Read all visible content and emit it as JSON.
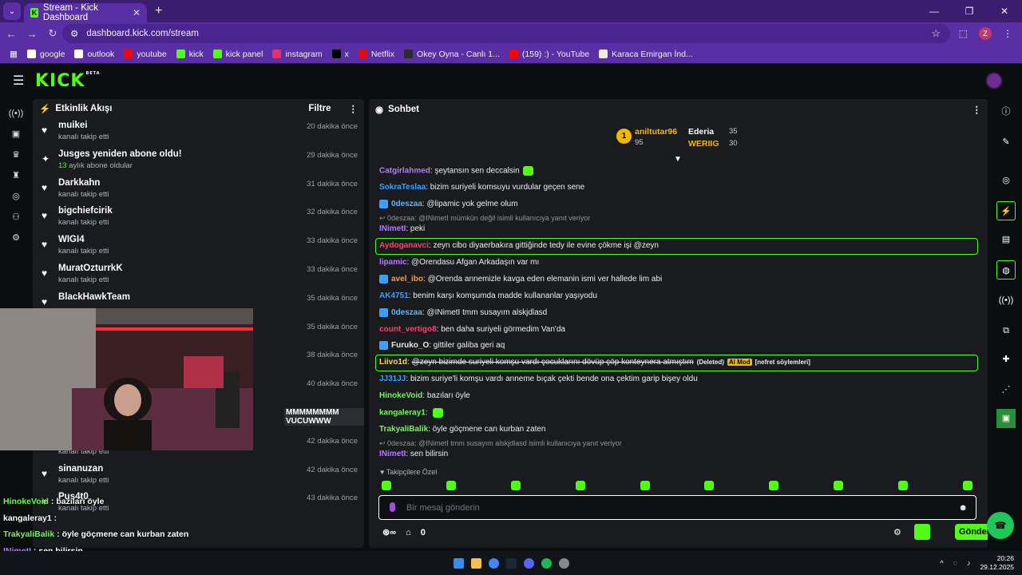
{
  "browser": {
    "tab_title": "Stream - Kick Dashboard",
    "url": "dashboard.kick.com/stream",
    "profile_initial": "Z",
    "bookmarks": [
      {
        "label": "google",
        "color": "#ffffff"
      },
      {
        "label": "outlook",
        "color": "#ffffff"
      },
      {
        "label": "youtube",
        "color": "#ff0000"
      },
      {
        "label": "kick",
        "color": "#53fc18"
      },
      {
        "label": "kick panel",
        "color": "#53fc18"
      },
      {
        "label": "instagram",
        "color": "#e1306c"
      },
      {
        "label": "x",
        "color": "#000000"
      },
      {
        "label": "Netflix",
        "color": "#e50914"
      },
      {
        "label": "Okey Oyna - Canlı 1...",
        "color": "#2c2c2c"
      },
      {
        "label": "(159) :) - YouTube",
        "color": "#ff0000"
      },
      {
        "label": "Karaca Emirgan İnd...",
        "color": "#eaeaea"
      }
    ]
  },
  "header": {
    "logo": "KICK",
    "logo_badge": "BETA"
  },
  "activity": {
    "title": "Etkinlik Akışı",
    "filter_label": "Filtre",
    "items": [
      {
        "name": "muikei",
        "sub": "kanalı takip etti",
        "time": "20 dakika önce",
        "icon": "heart"
      },
      {
        "name": "Jusges yeniden abone oldu!",
        "sub_count": "13",
        "sub": " aylık abone oldular",
        "time": "29 dakika önce",
        "icon": "sparkle"
      },
      {
        "name": "Darkkahn",
        "sub": "kanalı takip etti",
        "time": "31 dakika önce",
        "icon": "heart"
      },
      {
        "name": "bigchiefcirik",
        "sub": "kanalı takip etti",
        "time": "32 dakika önce",
        "icon": "heart"
      },
      {
        "name": "WIGI4",
        "sub": "kanalı takip etti",
        "time": "33 dakika önce",
        "icon": "heart"
      },
      {
        "name": "MuratOzturrkK",
        "sub": "kanalı takip etti",
        "time": "33 dakika önce",
        "icon": "heart"
      },
      {
        "name": "BlackHawkTeam",
        "sub": "",
        "time": "35 dakika önce",
        "icon": "heart"
      },
      {
        "name": "",
        "sub": "",
        "time": "35 dakika önce",
        "icon": ""
      },
      {
        "name": "",
        "sub": "",
        "time": "38 dakika önce",
        "icon": ""
      },
      {
        "name": "",
        "sub": "",
        "time": "40 dakika önce",
        "icon": ""
      },
      {
        "name": "",
        "sub": "",
        "time": "41 dakika önce",
        "icon": ""
      },
      {
        "name": "rasheet",
        "sub": "kanalı takip etti",
        "time": "42 dakika önce",
        "icon": "heart"
      },
      {
        "name": "sinanuzan",
        "sub": "kanalı takip etti",
        "time": "42 dakika önce",
        "icon": "heart"
      },
      {
        "name": "Pus4t0",
        "sub": "kanalı takip etti",
        "time": "43 dakika önce",
        "icon": "heart"
      }
    ],
    "highlight_msg": "MMMMMMMM VUCUWWW"
  },
  "overlay_chat": [
    {
      "user": "HinokeVoid",
      "user_color": "#6dfc4f",
      "text": "bazıları öyle"
    },
    {
      "user": "kangaleray1",
      "user_color": "#ffffff",
      "text": ""
    },
    {
      "user": "TrakyaliBalik",
      "user_color": "#6dfc4f",
      "text": "öyle göçmene can kurban zaten"
    },
    {
      "user": "INimetI",
      "user_color": "#b57aff",
      "text": "sen bilirsin"
    }
  ],
  "chat": {
    "title": "Sohbet",
    "leaderboard": {
      "rank": "1",
      "top_user": "aniltutar96",
      "top_points": "95",
      "second_user": "Ederia",
      "second_points": "35",
      "third_user": "WERIIG",
      "third_points": "30"
    },
    "messages": [
      {
        "user": "Catgirlahmed",
        "color": "#b57aff",
        "text": "şeytansın sen deccalsin",
        "emote": true
      },
      {
        "user": "SokraTeslaa",
        "color": "#3aa0ff",
        "text": "bizim suriyeli komsuyu vurdular geçen sene"
      },
      {
        "user": "0deszaa",
        "color": "#57b7ff",
        "text": "@lipamic yok gelme olum",
        "badge": true
      },
      {
        "reply": "0deszaa: @INimetI mümkün değil isimli kullanıcıya yanıt veriyor"
      },
      {
        "user": "INimetI",
        "color": "#b57aff",
        "text": "peki"
      },
      {
        "user": "Aydoganavci",
        "color": "#ff3f6e",
        "text": "zeyn cibo diyaerbakıra gittiğinde tedy ile evine çökme işi @zeyn",
        "highlight": true
      },
      {
        "user": "lipamic",
        "color": "#b57aff",
        "text": "@Orendasu Afgan Arkadaşın var mı"
      },
      {
        "user": "avel_ibo",
        "color": "#ff9a3a",
        "text": "@Orenda annemizle kavga eden elemanin ismi ver hallede lim abi",
        "badge": true
      },
      {
        "user": "AK4751",
        "color": "#3aa0ff",
        "text": "benim karşı komşumda madde kullananlar yaşıyodu"
      },
      {
        "user": "0deszaa",
        "color": "#57b7ff",
        "text": "@INimetI tmm susayım alskjdlasd",
        "badge": true
      },
      {
        "user": "count_vertigo8",
        "color": "#ff3f6e",
        "text": "ben daha suriyeli görmedim Van'da"
      },
      {
        "user": "Furuko_O",
        "color": "#e8e8e8",
        "text": "gittiler galiba geri aq",
        "badge": true
      },
      {
        "user": "Liivo1d",
        "color": "#ffd84d",
        "text": "@zeyn bizimde suriyeli komşu vardı çocuklarını dövüp çöp konteynera atmıştım",
        "deleted": "(Deleted)",
        "mod": "AI Mod",
        "reason": "[nefret söylemleri]",
        "highlight": true
      },
      {
        "user": "JJ31JJ",
        "color": "#3aa0ff",
        "text": "bizim suriye'li komşu vardı anneme bıçak çekti bende ona çektim garip bişey oldu"
      },
      {
        "user": "HinokeVoid",
        "color": "#6dfc4f",
        "text": "bazıları öyle"
      },
      {
        "user": "kangaleray1",
        "color": "#6dfc4f",
        "text": "",
        "emote": true
      },
      {
        "user": "TrakyaliBalik",
        "color": "#6dfc4f",
        "text": "öyle göçmene can kurban zaten"
      },
      {
        "reply": "0deszaa: @INimetI tmm susayım alskjdlasd isimli kullanıcıya yanıt veriyor"
      },
      {
        "user": "INimetI",
        "color": "#b57aff",
        "text": "sen bilirsin"
      }
    ],
    "followers_only": "Takipçilere Özel",
    "input_placeholder": "Bir mesaj gönderin",
    "send_label": "Gönder",
    "viewer_count": "0"
  },
  "taskbar": {
    "time": "20:26",
    "date": "29.12.2025"
  },
  "colors": {
    "accent": "#53fc18",
    "browser": "#5a2fa5",
    "panel": "#191b1f"
  }
}
